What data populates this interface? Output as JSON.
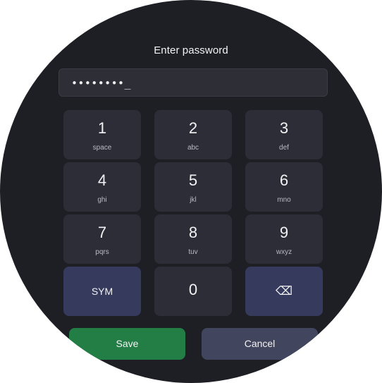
{
  "dialog": {
    "title": "Enter password",
    "password_display": "••••••••_"
  },
  "keypad": {
    "keys": [
      {
        "digit": "1",
        "letters": "space"
      },
      {
        "digit": "2",
        "letters": "abc"
      },
      {
        "digit": "3",
        "letters": "def"
      },
      {
        "digit": "4",
        "letters": "ghi"
      },
      {
        "digit": "5",
        "letters": "jkl"
      },
      {
        "digit": "6",
        "letters": "mno"
      },
      {
        "digit": "7",
        "letters": "pqrs"
      },
      {
        "digit": "8",
        "letters": "tuv"
      },
      {
        "digit": "9",
        "letters": "wxyz"
      }
    ],
    "sym_label": "SYM",
    "zero_label": "0",
    "backspace_glyph": "⌫"
  },
  "actions": {
    "save_label": "Save",
    "cancel_label": "Cancel"
  },
  "colors": {
    "background": "#1e1f25",
    "key": "#2c2d36",
    "key_accent": "#363a5c",
    "save": "#237e46",
    "cancel": "#42455e"
  }
}
